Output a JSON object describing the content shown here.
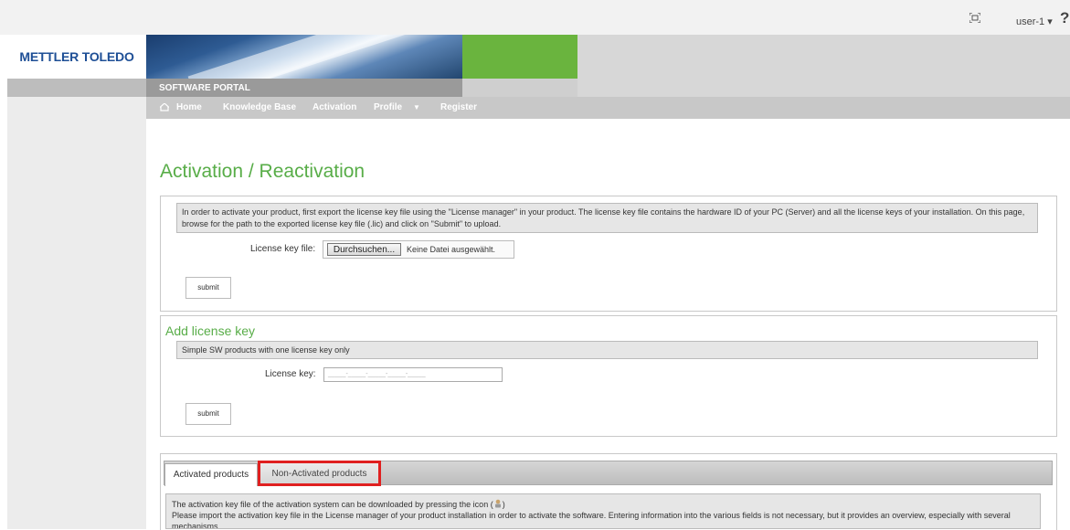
{
  "topbar": {
    "user_label": "user-1 ▾",
    "help_label": "?"
  },
  "logo": {
    "text": "METTLER TOLEDO"
  },
  "banner": {
    "portal_label": "SOFTWARE PORTAL"
  },
  "nav": {
    "items": [
      "Home",
      "Knowledge Base",
      "Activation",
      "Profile",
      "Register"
    ],
    "profile_caret": "▼"
  },
  "page": {
    "title": "Activation / Reactivation"
  },
  "activation_panel": {
    "info": "In order to activate your product, first export the license key file using the \"License manager\" in your product. The license key file contains the hardware ID of your PC (Server) and all the license keys of your installation. On this page, browse for the path to the exported license key file (.lic) and click on \"Submit\" to upload.",
    "file_label": "License key file:",
    "browse_button": "Durchsuchen...",
    "no_file_text": "Keine Datei ausgewählt.",
    "submit_label": "submit"
  },
  "add_key_panel": {
    "title": "Add license key",
    "info": "Simple SW products with one license key only",
    "key_label": "License key:",
    "key_placeholder": "_____-_____-_____-_____-_____",
    "submit_label": "submit"
  },
  "tabs": {
    "active": "Activated products",
    "inactive": "Non-Activated products"
  },
  "footer": {
    "line1_pre": "The activation key file of the activation system can be downloaded by pressing the icon (",
    "line1_post": ")",
    "line2": "Please import the activation key file in the License manager of your product installation in order to activate the software. Entering information into the various fields is not necessary, but it provides an overview, especially with several mechanisms."
  },
  "colors": {
    "accent_green": "#58ad48",
    "brand_blue": "#1e4f96",
    "highlight_red": "#e02020"
  }
}
